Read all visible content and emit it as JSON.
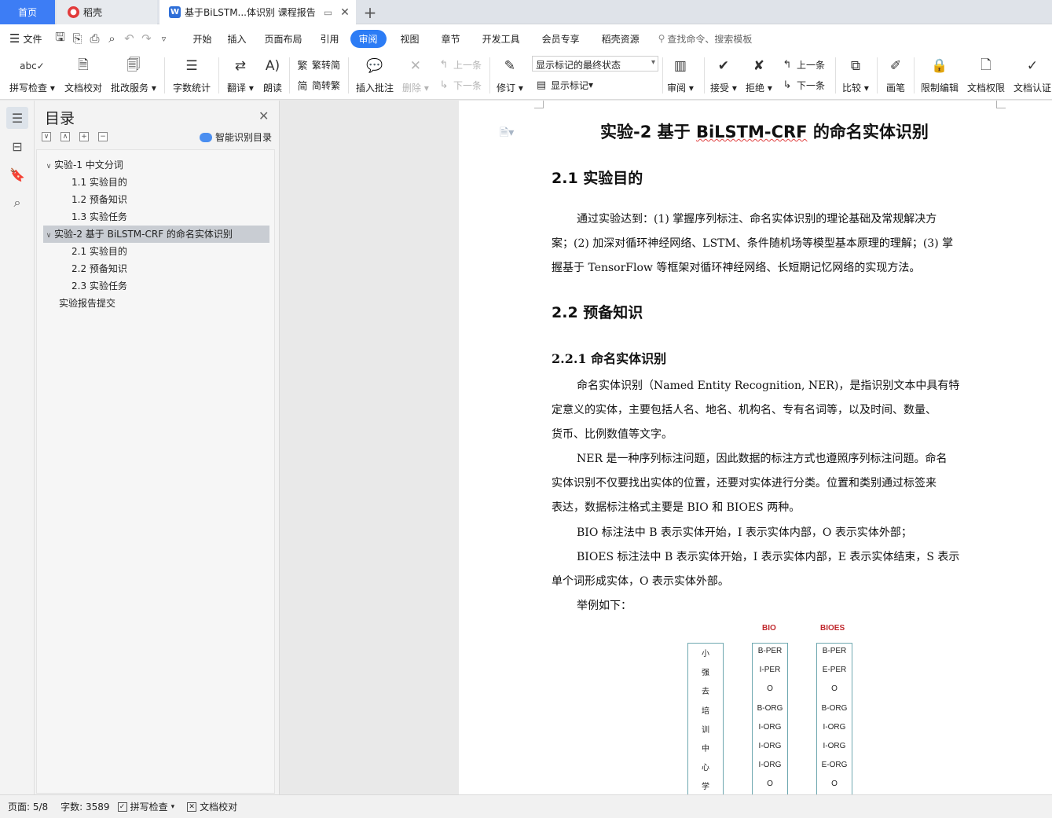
{
  "tabs": {
    "home": "首页",
    "daoke": "稻壳",
    "doc": "基于BiLSTM...体识别 课程报告"
  },
  "menu": {
    "file": "文件",
    "items": [
      "开始",
      "插入",
      "页面布局",
      "引用",
      "审阅",
      "视图",
      "章节",
      "开发工具",
      "会员专享",
      "稻壳资源"
    ],
    "active": "审阅",
    "search": "查找命令、搜索模板"
  },
  "ribbon": {
    "spell": "拼写检查",
    "proof": "文档校对",
    "correct": "批改服务",
    "count": "字数统计",
    "translate": "翻译",
    "read": "朗读",
    "t2s": "繁转简",
    "s2t": "简转繁",
    "insert_comment": "插入批注",
    "delete": "删除",
    "prev": "上一条",
    "next": "下一条",
    "revise": "修订",
    "markup_state": "显示标记的最终状态",
    "show_markup": "显示标记",
    "review": "审阅",
    "accept": "接受",
    "reject": "拒绝",
    "prev2": "上一条",
    "next2": "下一条",
    "compare": "比较",
    "pen": "画笔",
    "restrict": "限制编辑",
    "rights": "文档权限",
    "cert": "文档认证"
  },
  "nav": {
    "title": "目录",
    "smart": "智能识别目录",
    "toc": [
      "实验-1  中文分词",
      "1.1  实验目的",
      "1.2  预备知识",
      "1.3  实验任务",
      "实验-2  基于 BiLSTM-CRF 的命名实体识别",
      "2.1  实验目的",
      "2.2  预备知识",
      "2.3  实验任务",
      "实验报告提交"
    ]
  },
  "doc": {
    "title_pre": "实验-2 基于 ",
    "title_ul": "BiLSTM-CRF",
    "title_post": " 的命名实体识别",
    "h_21": "2.1  实验目的",
    "p1": [
      "通过实验达到：(1) 掌握序列标注、命名实体识别的理论基础及常规解决方",
      "案；(2) 加深对循环神经网络、LSTM、条件随机场等模型基本原理的理解；(3) 掌",
      "握基于 TensorFlow 等框架对循环神经网络、长短期记忆网络的实现方法。"
    ],
    "h_22": "2.2  预备知识",
    "h_221": "2.2.1  命名实体识别",
    "p2": [
      "命名实体识别（Named Entity Recognition, NER)，是指识别文本中具有特",
      "定意义的实体，主要包括人名、地名、机构名、专有名词等，以及时间、数量、",
      "货币、比例数值等文字。"
    ],
    "p3": [
      "NER 是一种序列标注问题，因此数据的标注方式也遵照序列标注问题。命名",
      "实体识别不仅要找出实体的位置，还要对实体进行分类。位置和类别通过标签来",
      "表达，数据标注格式主要是 BIO 和 BIOES 两种。"
    ],
    "p4": "BIO 标注法中 B 表示实体开始，I 表示实体内部，O 表示实体外部；",
    "p5": [
      "BIOES 标注法中 B 表示实体开始，I 表示实体内部，E 表示实体结束，S 表示",
      "单个词形成实体，O 表示实体外部。"
    ],
    "p6": "举例如下：",
    "fig": {
      "bio_header": "BIO",
      "bioes_header": "BIOES",
      "chars": [
        "小",
        "强",
        "去",
        "培",
        "训",
        "中",
        "心",
        "学"
      ],
      "bio": [
        "B-PER",
        "I-PER",
        "O",
        "B-ORG",
        "I-ORG",
        "I-ORG",
        "I-ORG",
        "O"
      ],
      "bioes": [
        "B-PER",
        "E-PER",
        "O",
        "B-ORG",
        "I-ORG",
        "I-ORG",
        "E-ORG",
        "O"
      ]
    }
  },
  "status": {
    "page": "页面: 5/8",
    "words": "字数: 3589",
    "spell": "拼写检查",
    "proof": "文档校对"
  }
}
